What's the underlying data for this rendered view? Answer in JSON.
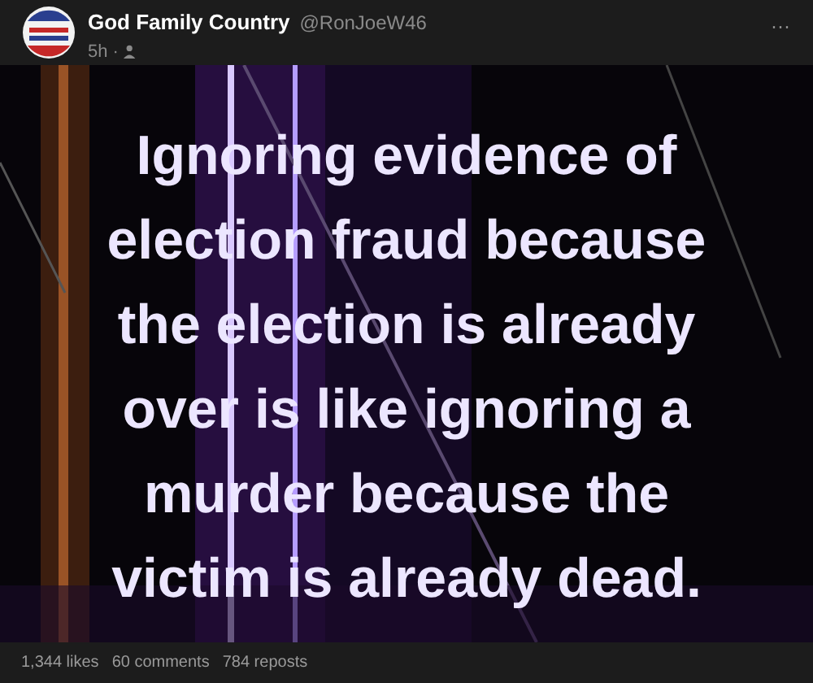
{
  "post": {
    "author": "God Family Country",
    "handle": "@RonJoeW46",
    "time": "5h ·",
    "more": "···",
    "image_text": [
      "Ignoring evidence of",
      "election fraud because",
      "the election is already",
      "over is like ignoring a",
      "murder because the",
      "victim is already dead."
    ],
    "stats": [
      "1,344 likes",
      "60 comments",
      "784 reposts"
    ]
  }
}
